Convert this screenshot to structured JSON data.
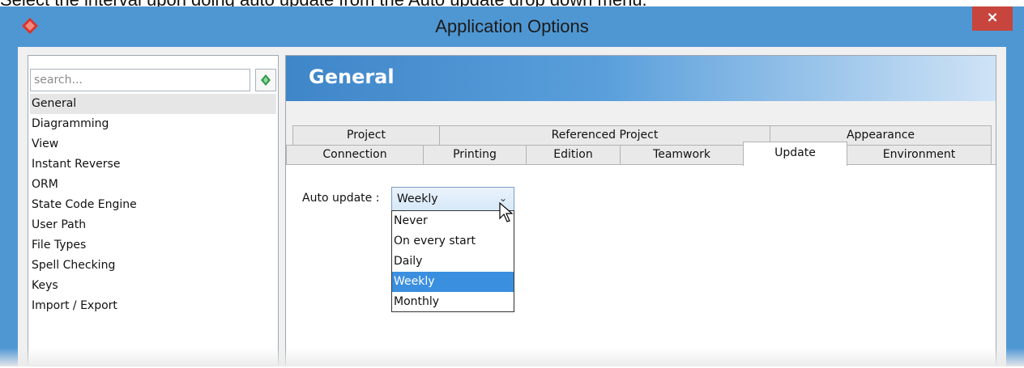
{
  "caption": {
    "text": "Select the interval upon doing auto update from the Auto update drop down menu."
  },
  "window": {
    "title": "Application Options",
    "close_label": "×",
    "accent_color": "#4f97d3",
    "close_color": "#c7453d"
  },
  "sidebar": {
    "search_placeholder": "search...",
    "items": [
      {
        "label": "General",
        "selected": true
      },
      {
        "label": "Diagramming"
      },
      {
        "label": "View"
      },
      {
        "label": "Instant Reverse"
      },
      {
        "label": "ORM"
      },
      {
        "label": "State Code Engine"
      },
      {
        "label": "User Path"
      },
      {
        "label": "File Types"
      },
      {
        "label": "Spell Checking"
      },
      {
        "label": "Keys"
      },
      {
        "label": "Import / Export"
      }
    ]
  },
  "main": {
    "title": "General",
    "tabs_row1": [
      {
        "label": "Project"
      },
      {
        "label": "Referenced Project"
      },
      {
        "label": "Appearance"
      }
    ],
    "tabs_row2": [
      {
        "label": "Connection"
      },
      {
        "label": "Printing"
      },
      {
        "label": "Edition"
      },
      {
        "label": "Teamwork"
      },
      {
        "label": "Update",
        "active": true
      },
      {
        "label": "Environment"
      }
    ],
    "auto_update": {
      "label": "Auto update :",
      "value": "Weekly",
      "options": [
        "Never",
        "On every start",
        "Daily",
        "Weekly",
        "Monthly"
      ],
      "highlighted": "Weekly",
      "highlight_color": "#3b8fdf"
    }
  }
}
